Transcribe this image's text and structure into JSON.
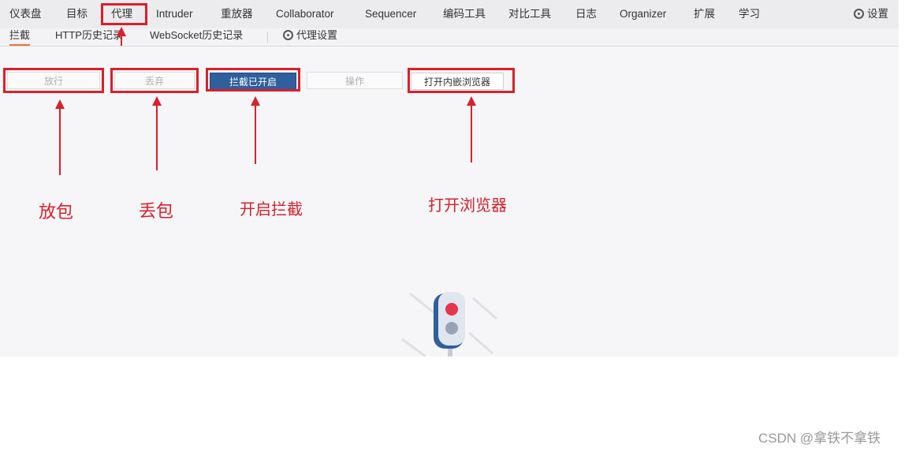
{
  "topnav": {
    "items": [
      "仪表盘",
      "目标",
      "代理",
      "Intruder",
      "重放器",
      "Collaborator",
      "Sequencer",
      "编码工具",
      "对比工具",
      "日志",
      "Organizer",
      "扩展",
      "学习"
    ],
    "settings_label": "设置"
  },
  "subnav": {
    "items": [
      "拦截",
      "HTTP历史记录",
      "WebSocket历史记录"
    ],
    "proxy_settings_label": "代理设置"
  },
  "toolbar": {
    "forward_label": "放行",
    "drop_label": "丢弃",
    "intercept_label": "拦截已开启",
    "action_label": "操作",
    "browser_label": "打开内嵌浏览器"
  },
  "annotations": {
    "forward": "放包",
    "drop": "丢包",
    "intercept": "开启拦截",
    "browser": "打开浏览器"
  },
  "colors": {
    "annotation_red": "#d9202c",
    "primary_blue": "#2f5f9c",
    "active_tab_underline": "#e8773f"
  },
  "watermark": "CSDN @拿铁不拿铁"
}
